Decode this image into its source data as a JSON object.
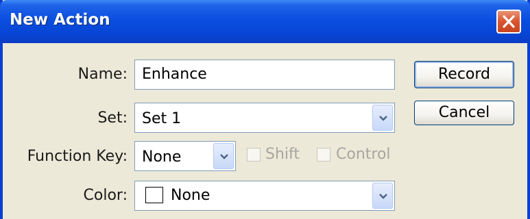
{
  "window": {
    "title": "New Action",
    "close_icon": "close-icon"
  },
  "form": {
    "name_label": "Name:",
    "name_value": "Enhance",
    "set_label": "Set:",
    "set_value": "Set 1",
    "function_key_label": "Function Key:",
    "function_key_value": "None",
    "shift_label": "Shift",
    "shift_checked": false,
    "control_label": "Control",
    "control_checked": false,
    "color_label": "Color:",
    "color_value": "None",
    "color_swatch": "#ffffff"
  },
  "buttons": {
    "record_label": "Record",
    "cancel_label": "Cancel"
  },
  "theme": {
    "titlebar_blue": "#0846d6",
    "close_red": "#d9552f",
    "dialog_bg": "#ece9d8",
    "field_border": "#7f9db9",
    "disabled_text": "#a7a6a0"
  }
}
